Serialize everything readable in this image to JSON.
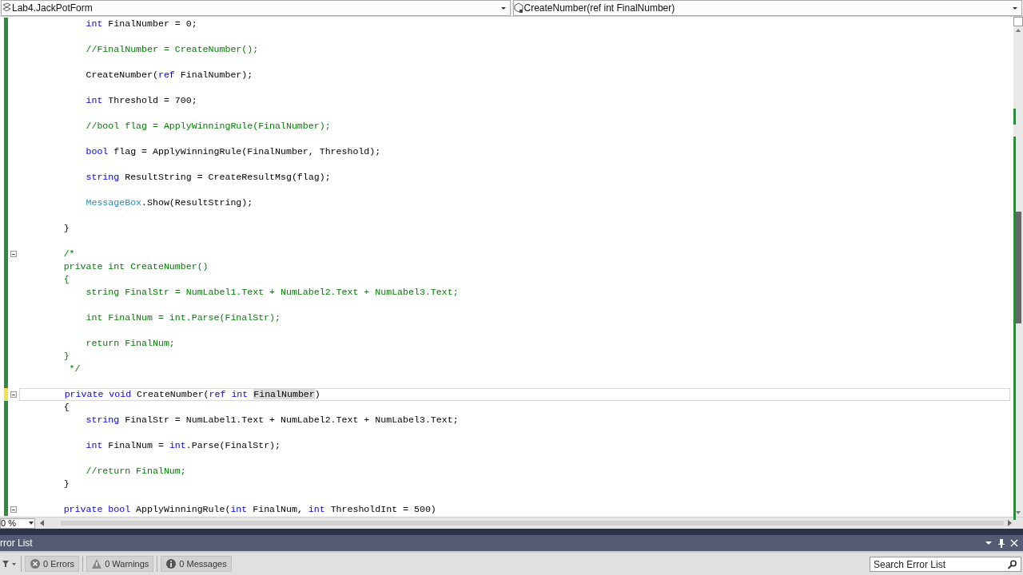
{
  "navigation": {
    "class_dropdown": "Lab4.JackPotForm",
    "member_dropdown": "CreateNumber(ref int FinalNumber)"
  },
  "code_lines": [
    {
      "unsaved": false,
      "foldable": false,
      "current": false,
      "tokens": [
        {
          "kind": "keyword",
          "text": "            int"
        },
        {
          "kind": "plain",
          "text": " FinalNumber = 0;"
        }
      ]
    },
    {
      "unsaved": false,
      "foldable": false,
      "current": false
    },
    {
      "unsaved": false,
      "foldable": false,
      "current": false,
      "tokens": [
        {
          "kind": "comment",
          "text": "            //FinalNumber = CreateNumber();"
        }
      ]
    },
    {
      "unsaved": false,
      "foldable": false,
      "current": false
    },
    {
      "unsaved": false,
      "foldable": false,
      "current": false,
      "tokens": [
        {
          "kind": "plain",
          "text": "            CreateNumber("
        },
        {
          "kind": "keyword",
          "text": "ref"
        },
        {
          "kind": "plain",
          "text": " FinalNumber);"
        }
      ]
    },
    {
      "unsaved": false,
      "foldable": false,
      "current": false
    },
    {
      "unsaved": false,
      "foldable": false,
      "current": false,
      "tokens": [
        {
          "kind": "keyword",
          "text": "            int"
        },
        {
          "kind": "plain",
          "text": " Threshold = 700;"
        }
      ]
    },
    {
      "unsaved": false,
      "foldable": false,
      "current": false
    },
    {
      "unsaved": false,
      "foldable": false,
      "current": false,
      "tokens": [
        {
          "kind": "comment",
          "text": "            //bool flag = ApplyWinningRule(FinalNumber);"
        }
      ]
    },
    {
      "unsaved": false,
      "foldable": false,
      "current": false
    },
    {
      "unsaved": false,
      "foldable": false,
      "current": false,
      "tokens": [
        {
          "kind": "keyword",
          "text": "            bool"
        },
        {
          "kind": "plain",
          "text": " flag = ApplyWinningRule(FinalNumber, Threshold);"
        }
      ]
    },
    {
      "unsaved": false,
      "foldable": false,
      "current": false
    },
    {
      "unsaved": false,
      "foldable": false,
      "current": false,
      "tokens": [
        {
          "kind": "keyword",
          "text": "            string"
        },
        {
          "kind": "plain",
          "text": " ResultString = CreateResultMsg(flag);"
        }
      ]
    },
    {
      "unsaved": false,
      "foldable": false,
      "current": false
    },
    {
      "unsaved": false,
      "foldable": false,
      "current": false,
      "tokens": [
        {
          "kind": "type",
          "text": "            MessageBox"
        },
        {
          "kind": "plain",
          "text": ".Show(ResultString);"
        }
      ]
    },
    {
      "unsaved": false,
      "foldable": false,
      "current": false
    },
    {
      "unsaved": false,
      "foldable": false,
      "current": false,
      "tokens": [
        {
          "kind": "plain",
          "text": "        }"
        }
      ]
    },
    {
      "unsaved": false,
      "foldable": false,
      "current": false
    },
    {
      "unsaved": false,
      "foldable": true,
      "current": false,
      "tokens": [
        {
          "kind": "comment",
          "text": "        /*"
        }
      ]
    },
    {
      "unsaved": false,
      "foldable": false,
      "current": false,
      "tokens": [
        {
          "kind": "comment",
          "text": "        private int CreateNumber()"
        }
      ]
    },
    {
      "unsaved": false,
      "foldable": false,
      "current": false,
      "tokens": [
        {
          "kind": "comment",
          "text": "        {"
        }
      ]
    },
    {
      "unsaved": false,
      "foldable": false,
      "current": false,
      "tokens": [
        {
          "kind": "comment",
          "text": "            string FinalStr = NumLabel1.Text + NumLabel2.Text + NumLabel3.Text;"
        }
      ]
    },
    {
      "unsaved": false,
      "foldable": false,
      "current": false
    },
    {
      "unsaved": false,
      "foldable": false,
      "current": false,
      "tokens": [
        {
          "kind": "comment",
          "text": "            int FinalNum = int.Parse(FinalStr);"
        }
      ]
    },
    {
      "unsaved": false,
      "foldable": false,
      "current": false
    },
    {
      "unsaved": false,
      "foldable": false,
      "current": false,
      "tokens": [
        {
          "kind": "comment",
          "text": "            return FinalNum;"
        }
      ]
    },
    {
      "unsaved": false,
      "foldable": false,
      "current": false,
      "tokens": [
        {
          "kind": "comment",
          "text": "        }"
        }
      ]
    },
    {
      "unsaved": false,
      "foldable": false,
      "current": false,
      "tokens": [
        {
          "kind": "comment",
          "text": "         */"
        }
      ]
    },
    {
      "unsaved": false,
      "foldable": false,
      "current": false
    },
    {
      "unsaved": true,
      "foldable": true,
      "current": true,
      "tokens": [
        {
          "kind": "keyword",
          "text": "        private void"
        },
        {
          "kind": "plain",
          "text": " CreateNumber("
        },
        {
          "kind": "keyword",
          "text": "ref int"
        },
        {
          "kind": "highlight",
          "text": " FinalNumber"
        },
        {
          "kind": "plain",
          "text": ")"
        }
      ]
    },
    {
      "unsaved": false,
      "foldable": false,
      "current": false,
      "tokens": [
        {
          "kind": "plain",
          "text": "        {"
        }
      ]
    },
    {
      "unsaved": false,
      "foldable": false,
      "current": false,
      "tokens": [
        {
          "kind": "keyword",
          "text": "            string"
        },
        {
          "kind": "plain",
          "text": " FinalStr = NumLabel1.Text + NumLabel2.Text + NumLabel3.Text;"
        }
      ]
    },
    {
      "unsaved": false,
      "foldable": false,
      "current": false
    },
    {
      "unsaved": false,
      "foldable": false,
      "current": false,
      "tokens": [
        {
          "kind": "keyword",
          "text": "            int"
        },
        {
          "kind": "plain",
          "text": " FinalNum = "
        },
        {
          "kind": "keyword",
          "text": "int"
        },
        {
          "kind": "plain",
          "text": ".Parse(FinalStr);"
        }
      ]
    },
    {
      "unsaved": false,
      "foldable": false,
      "current": false
    },
    {
      "unsaved": false,
      "foldable": false,
      "current": false,
      "tokens": [
        {
          "kind": "comment",
          "text": "            //return FinalNum;"
        }
      ]
    },
    {
      "unsaved": false,
      "foldable": false,
      "current": false,
      "tokens": [
        {
          "kind": "plain",
          "text": "        }"
        }
      ]
    },
    {
      "unsaved": false,
      "foldable": false,
      "current": false
    },
    {
      "unsaved": false,
      "foldable": true,
      "current": false,
      "tokens": [
        {
          "kind": "keyword",
          "text": "        private bool"
        },
        {
          "kind": "plain",
          "text": " ApplyWinningRule("
        },
        {
          "kind": "keyword",
          "text": "int"
        },
        {
          "kind": "plain",
          "text": " FinalNum, "
        },
        {
          "kind": "keyword",
          "text": "int"
        },
        {
          "kind": "plain",
          "text": " ThresholdInt = 500)"
        }
      ]
    }
  ],
  "zoom": "0 %",
  "error_list": {
    "title": "rror List",
    "filters": [
      {
        "kind": "errors",
        "label": "0 Errors"
      },
      {
        "kind": "warnings",
        "label": "0 Warnings"
      },
      {
        "kind": "messages",
        "label": "0 Messages"
      }
    ],
    "search": {
      "placeholder": "Search Error List"
    }
  }
}
